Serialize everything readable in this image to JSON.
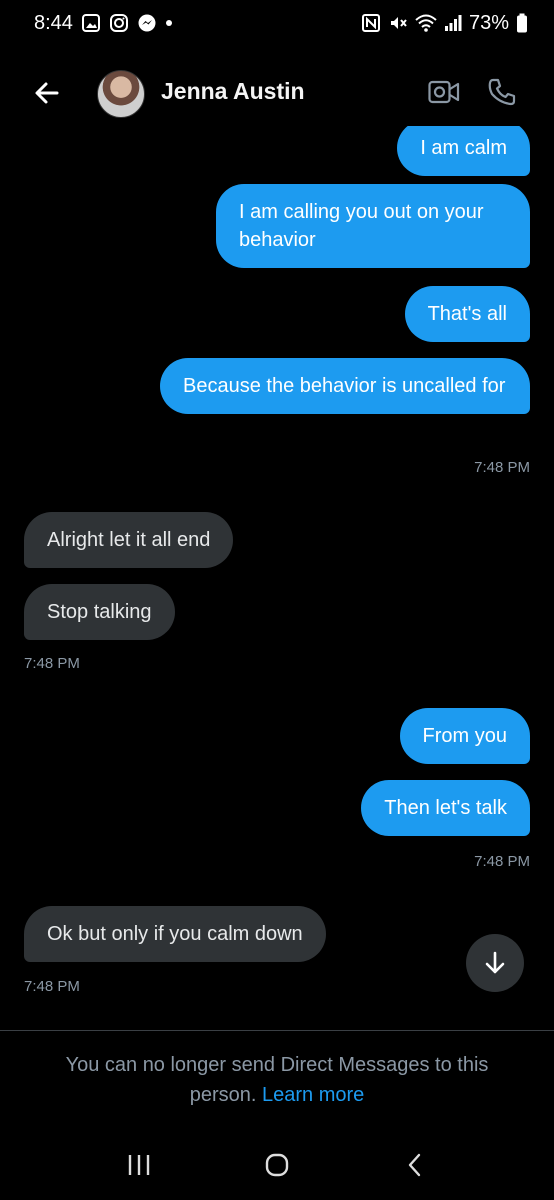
{
  "status_bar": {
    "time": "8:44",
    "battery": "73%"
  },
  "header": {
    "contact_name": "Jenna Austin",
    "back_icon": "arrow-left-icon",
    "video_icon": "video-call-icon",
    "call_icon": "phone-icon"
  },
  "messages": [
    {
      "id": "m1",
      "direction": "out",
      "text": "I am calm"
    },
    {
      "id": "m2",
      "direction": "out",
      "text": "I am calling you out on your behavior"
    },
    {
      "id": "m3",
      "direction": "out",
      "text": "That's all"
    },
    {
      "id": "m4",
      "direction": "out",
      "text": "Because the behavior is uncalled for"
    },
    {
      "id": "t1",
      "timestamp": "7:48 PM"
    },
    {
      "id": "m5",
      "direction": "in",
      "text": "Alright let it all end"
    },
    {
      "id": "m6",
      "direction": "in",
      "text": "Stop talking"
    },
    {
      "id": "t2",
      "timestamp": "7:48 PM"
    },
    {
      "id": "m7",
      "direction": "out",
      "text": "From you"
    },
    {
      "id": "m8",
      "direction": "out",
      "text": "Then let's talk"
    },
    {
      "id": "t3",
      "timestamp": "7:48 PM"
    },
    {
      "id": "m9",
      "direction": "in",
      "text": "Ok but only if you calm down"
    },
    {
      "id": "t4",
      "timestamp": "7:48 PM"
    }
  ],
  "footer": {
    "notice_text": "You can no longer send Direct Messages to this person.",
    "learn_more": "Learn more"
  },
  "colors": {
    "outgoing_bubble": "#1d9bf0",
    "incoming_bubble": "#2f3336",
    "background": "#000000",
    "link": "#1d9bf0"
  }
}
